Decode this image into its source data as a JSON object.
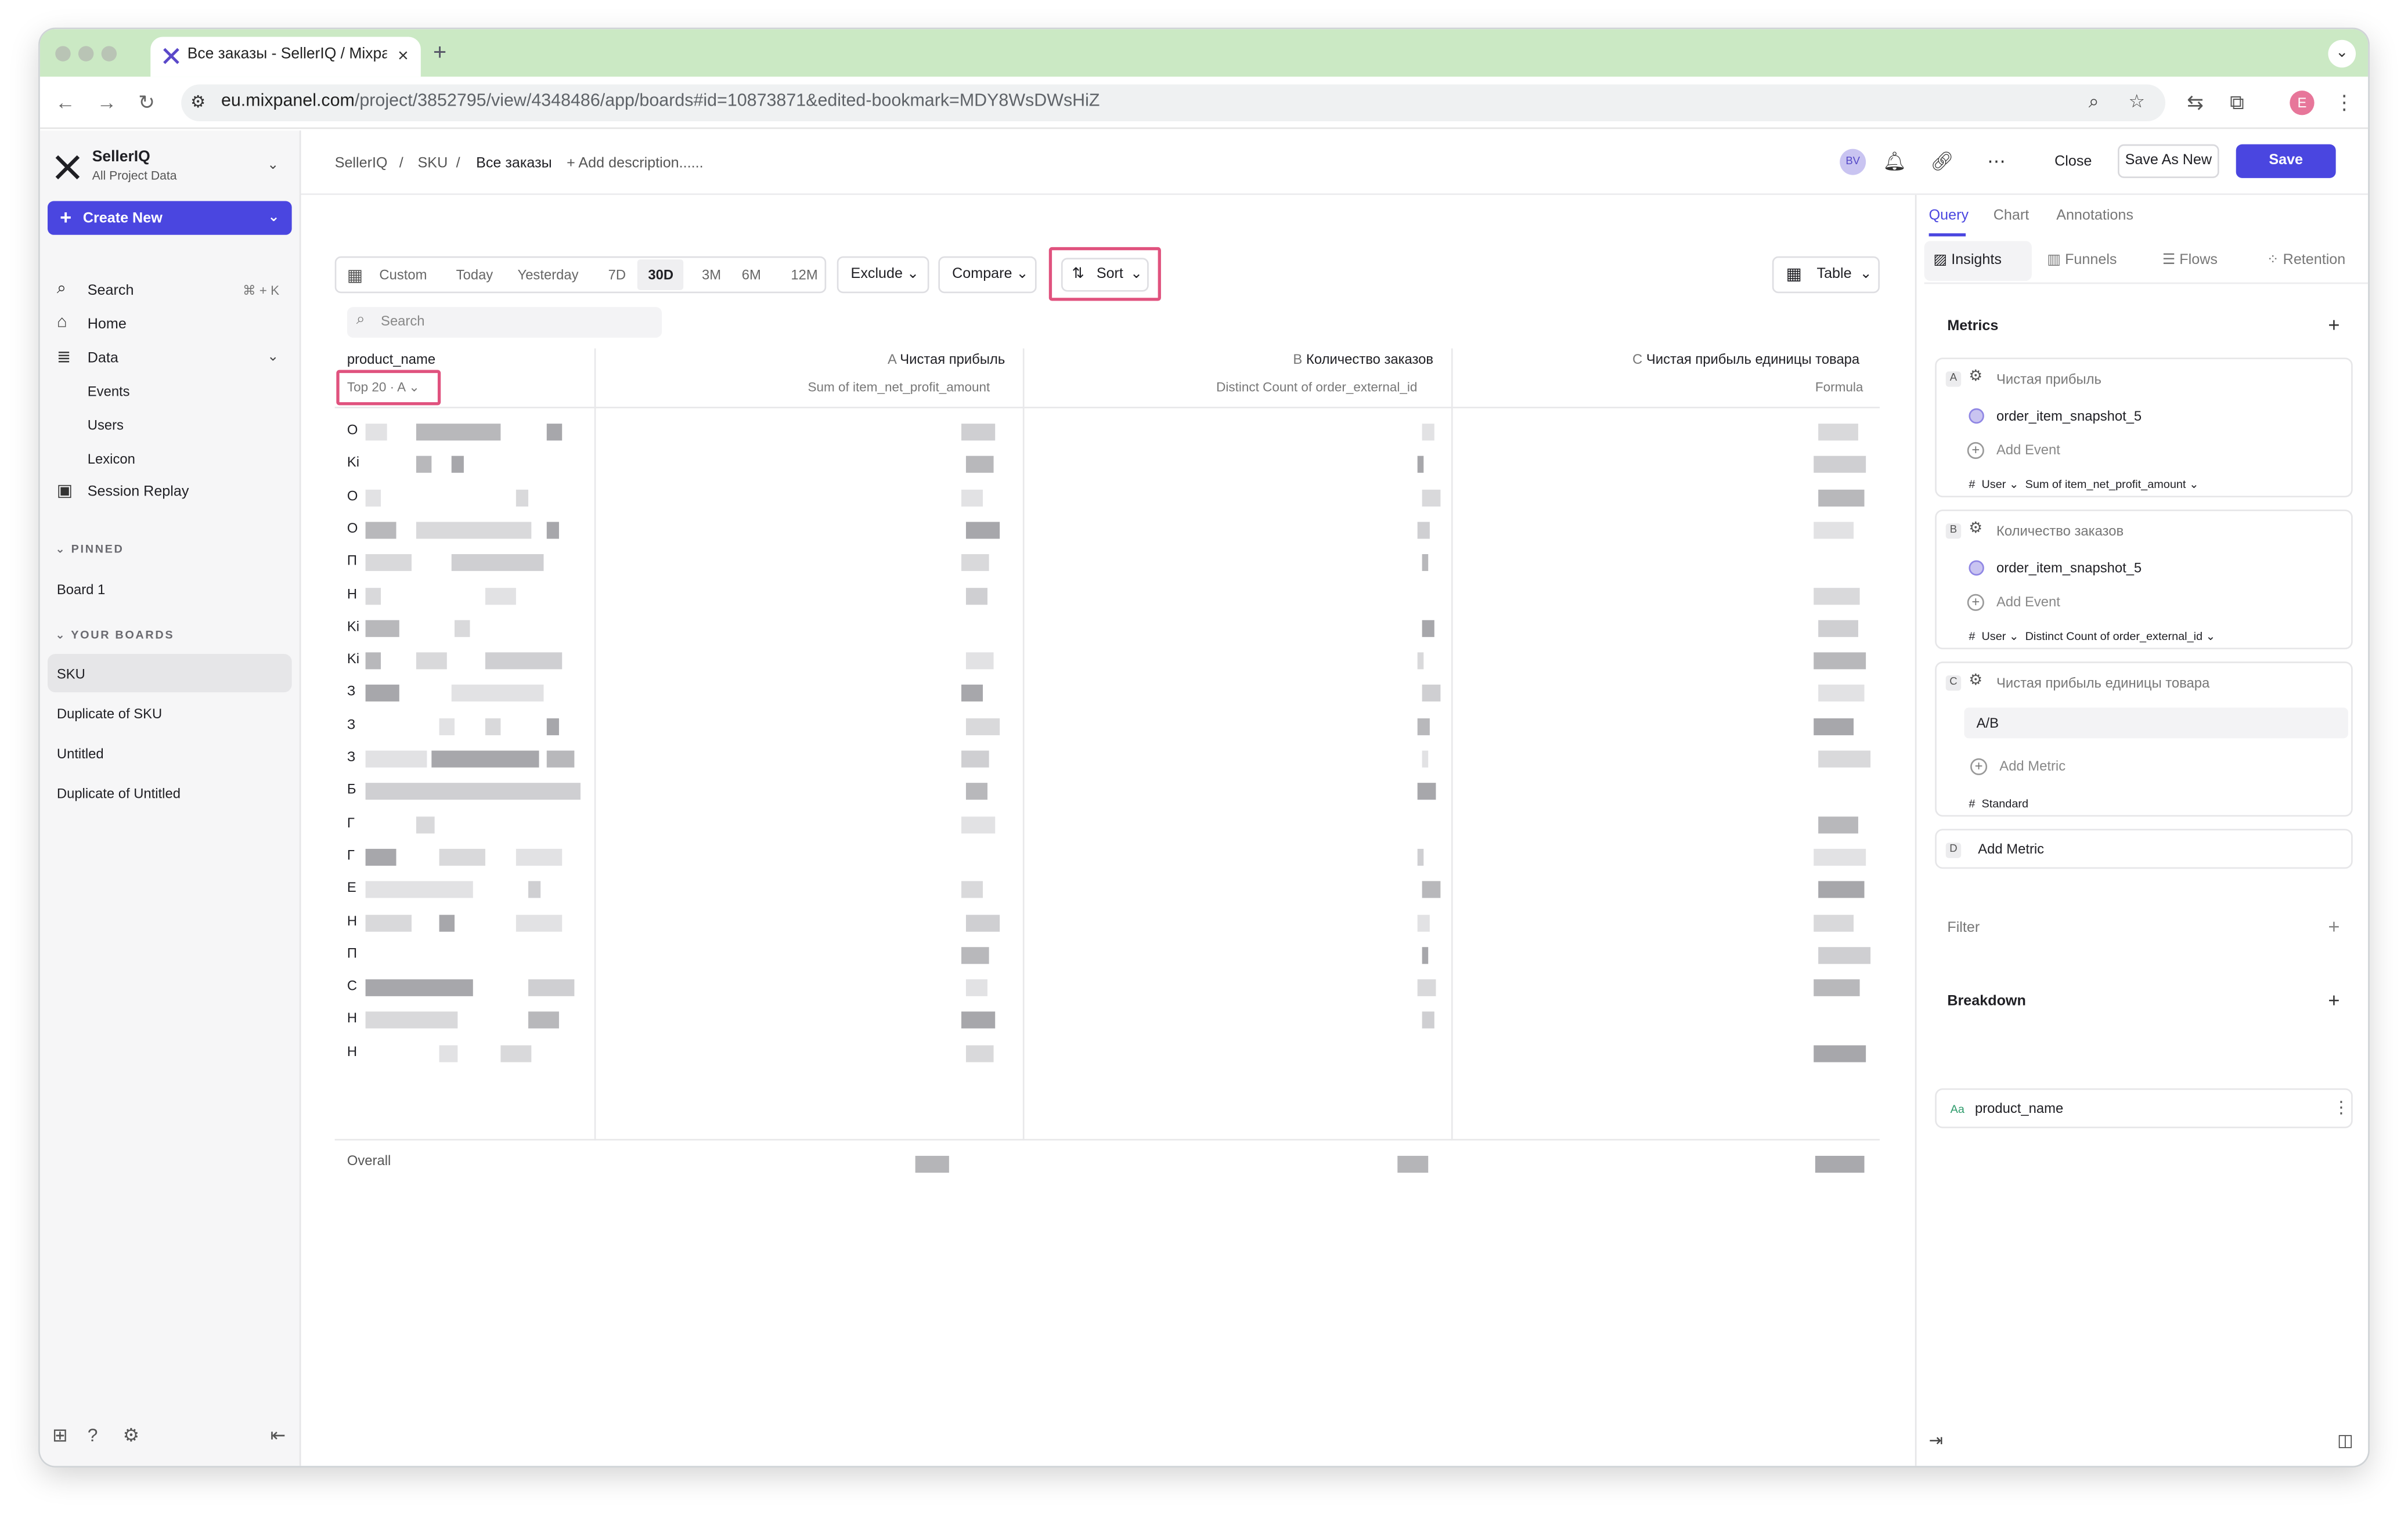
{
  "browser": {
    "tab_title": "Все заказы - SellerIQ / Mixpa",
    "url_host": "eu.mixpanel.com",
    "url_path": "/project/3852795/view/4348486/app/boards#id=10873871&edited-bookmark=MDY8WsDWsHiZ",
    "profile_initial": "E"
  },
  "sidebar": {
    "workspace_name": "SellerIQ",
    "workspace_sub": "All Project Data",
    "create_new": "Create New",
    "search": "Search",
    "search_shortcut": "⌘ + K",
    "home": "Home",
    "data": "Data",
    "events": "Events",
    "users": "Users",
    "lexicon": "Lexicon",
    "session_replay": "Session Replay",
    "pinned_header": "PINNED",
    "pinned": [
      "Board 1"
    ],
    "boards_header": "YOUR BOARDS",
    "boards": [
      "SKU",
      "Duplicate of SKU",
      "Untitled",
      "Duplicate of Untitled"
    ]
  },
  "topbar": {
    "crumb_1": "SellerIQ",
    "crumb_2": "SKU",
    "crumb_3": "Все заказы",
    "add_description": "+ Add description......",
    "avatar": "BV",
    "close": "Close",
    "save_as_new": "Save As New",
    "save": "Save"
  },
  "controls": {
    "dates": [
      "Custom",
      "Today",
      "Yesterday",
      "7D",
      "30D",
      "3M",
      "6M",
      "12M"
    ],
    "selected_date": "30D",
    "exclude": "Exclude",
    "compare": "Compare",
    "sort": "Sort",
    "table": "Table",
    "search_placeholder": "Search"
  },
  "table": {
    "first_col": "product_name",
    "top_n": "Top 20 · A",
    "columns": [
      {
        "letter": "A",
        "name": "Чистая прибыль",
        "sub": "Sum of item_net_profit_amount"
      },
      {
        "letter": "B",
        "name": "Количество заказов",
        "sub": "Distinct Count of order_external_id"
      },
      {
        "letter": "C",
        "name": "Чистая прибыль единицы товара",
        "sub": "Formula"
      }
    ],
    "row_prefixes": [
      "O",
      "Ki",
      "O",
      "O",
      "П",
      "Н",
      "Ki",
      "Ki",
      "З",
      "З",
      "З",
      "Б",
      "Г",
      "Г",
      "E",
      "Н",
      "П",
      "C",
      "Н",
      "Н"
    ],
    "overall": "Overall"
  },
  "panel": {
    "tabs": [
      "Query",
      "Chart",
      "Annotations"
    ],
    "query_types": [
      "Insights",
      "Funnels",
      "Flows",
      "Retention"
    ],
    "metrics_label": "Metrics",
    "metric_a": {
      "letter": "A",
      "name": "Чистая прибыль",
      "event": "order_item_snapshot_5",
      "add_event": "Add Event",
      "footer_user": "User",
      "footer_agg": "Sum of item_net_profit_amount"
    },
    "metric_b": {
      "letter": "B",
      "name": "Количество заказов",
      "event": "order_item_snapshot_5",
      "add_event": "Add Event",
      "footer_user": "User",
      "footer_agg": "Distinct Count of order_external_id"
    },
    "metric_c": {
      "letter": "C",
      "name": "Чистая прибыль единицы товара",
      "formula": "A/B",
      "add_metric": "Add Metric",
      "footer": "Standard"
    },
    "metric_d": {
      "letter": "D",
      "name": "Add Metric"
    },
    "filter_label": "Filter",
    "breakdown_label": "Breakdown",
    "breakdown_item": "product_name",
    "breakdown_type": "Aa"
  },
  "colors": {
    "accent": "#4a46e0",
    "highlight": "#e0527e",
    "tabbar": "#cbe9c4"
  }
}
